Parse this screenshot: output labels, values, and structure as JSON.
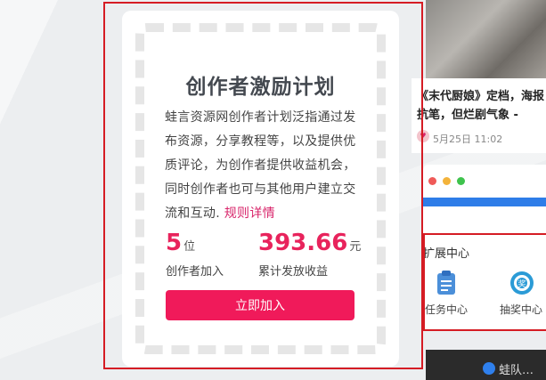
{
  "card": {
    "title": "创作者激励计划",
    "description": "蛙言资源网创作者计划泛指通过发布资源，分享教程等，以及提供优质评论，为创作者提供收益机会，同时创作者也可与其他用户建立交流和互动.",
    "rule_link": "规则详情",
    "stat_creators": {
      "value": "5",
      "unit": "位",
      "label": "创作者加入"
    },
    "stat_earnings": {
      "value": "393.66",
      "unit": "元",
      "label": "累计发放收益"
    },
    "join_button": "立即加入"
  },
  "news": {
    "title": "《末代厨娘》定档，海报抗笔，但烂剧气象 -",
    "meta": "5月25日 11:02"
  },
  "extension_center": {
    "title": "扩展中心",
    "items": [
      {
        "label": "任务中心",
        "icon": "clipboard-icon"
      },
      {
        "label": "抽奖中心",
        "icon": "lottery-icon"
      }
    ]
  },
  "bottom_text": "蛙队…",
  "colors": {
    "accent": "#f01a5a",
    "stat": "#e8235c",
    "link": "#d8246a",
    "annotation": "#d51c24"
  }
}
